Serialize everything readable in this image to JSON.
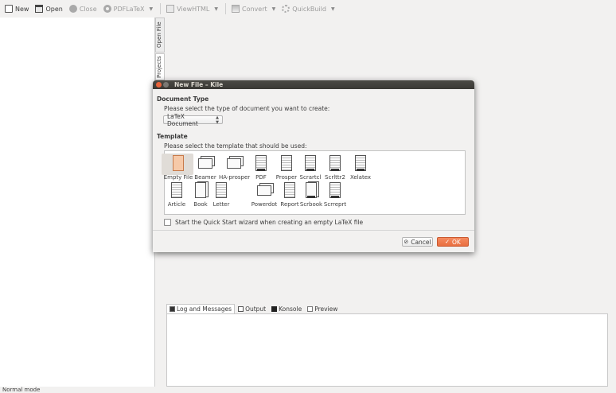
{
  "toolbar": {
    "items": [
      {
        "label": "New",
        "icon": "new-document-icon",
        "enabled": true
      },
      {
        "label": "Open",
        "icon": "folder-open-icon",
        "enabled": true
      },
      {
        "label": "Close",
        "icon": "close-circle-icon",
        "enabled": false
      },
      {
        "label": "PDFLaTeX",
        "icon": "gear-icon",
        "enabled": false
      },
      {
        "label": "ViewHTML",
        "icon": "view-icon",
        "enabled": false
      },
      {
        "label": "Convert",
        "icon": "convert-icon",
        "enabled": false
      },
      {
        "label": "QuickBuild",
        "icon": "quickbuild-icon",
        "enabled": false
      }
    ]
  },
  "side_tabs": {
    "open_file": "Open File",
    "projects": "Projects"
  },
  "dialog": {
    "title": "New File – Kile",
    "document_type_heading": "Document Type",
    "document_type_prompt": "Please select the type of document you want to create:",
    "document_type_selected": "LaTeX Document",
    "template_heading": "Template",
    "template_prompt": "Please select the template that should be used:",
    "templates": [
      {
        "label": "Empty File",
        "kind": "empty",
        "selected": true
      },
      {
        "label": "Beamer",
        "kind": "slides"
      },
      {
        "label": "HA-prosper",
        "kind": "slides"
      },
      {
        "label": "PDF",
        "kind": "badge"
      },
      {
        "label": "Prosper",
        "kind": "page"
      },
      {
        "label": "Scrartcl",
        "kind": "badge"
      },
      {
        "label": "Scrlttr2",
        "kind": "badge"
      },
      {
        "label": "Xelatex",
        "kind": "badge"
      },
      {
        "label": "Article",
        "kind": "page"
      },
      {
        "label": "Book",
        "kind": "book"
      },
      {
        "label": "Letter",
        "kind": "page"
      },
      {
        "label": "Powerdot",
        "kind": "slides"
      },
      {
        "label": "Report",
        "kind": "page"
      },
      {
        "label": "Scrbook",
        "kind": "book"
      },
      {
        "label": "Scrreprt",
        "kind": "badge"
      }
    ],
    "quickstart_label": "Start the Quick Start wizard when creating an empty LaTeX file",
    "quickstart_checked": false,
    "cancel_label": "Cancel",
    "ok_label": "OK"
  },
  "bottom_tabs": [
    {
      "label": "Log and Messages",
      "icon": "log-icon",
      "active": true
    },
    {
      "label": "Output",
      "icon": "output-icon",
      "active": false
    },
    {
      "label": "Konsole",
      "icon": "konsole-icon",
      "active": false
    },
    {
      "label": "Preview",
      "icon": "preview-icon",
      "active": false
    }
  ],
  "status": {
    "mode": "Normal mode"
  },
  "colors": {
    "accent": "#e96f41",
    "titlebar": "#3c3b37",
    "background": "#f2f1f0"
  }
}
